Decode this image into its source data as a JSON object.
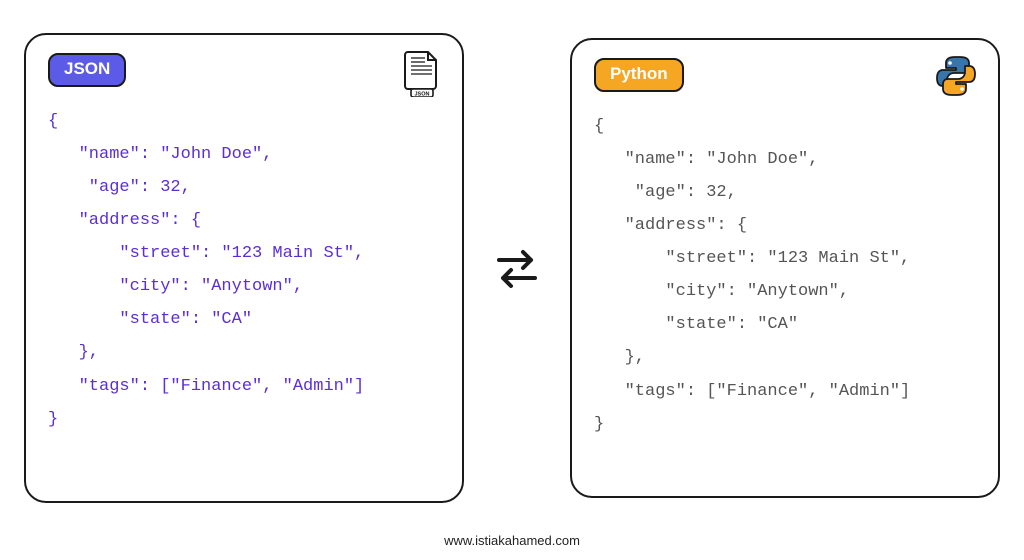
{
  "left_panel": {
    "badge": "JSON",
    "icon_label": "JSON",
    "code": "{\n   \"name\": \"John Doe\",\n    \"age\": 32,\n   \"address\": {\n       \"street\": \"123 Main St\",\n       \"city\": \"Anytown\",\n       \"state\": \"CA\"\n   },\n   \"tags\": [\"Finance\", \"Admin\"]\n}"
  },
  "right_panel": {
    "badge": "Python",
    "code": "{\n   \"name\": \"John Doe\",\n    \"age\": 32,\n   \"address\": {\n       \"street\": \"123 Main St\",\n       \"city\": \"Anytown\",\n       \"state\": \"CA\"\n   },\n   \"tags\": [\"Finance\", \"Admin\"]\n}"
  },
  "footer_text": "www.istiakahamed.com",
  "colors": {
    "json_badge": "#5b5be8",
    "python_badge": "#f5a623",
    "json_code": "#5a2ed8",
    "python_code": "#555555",
    "border": "#1a1a1a"
  }
}
